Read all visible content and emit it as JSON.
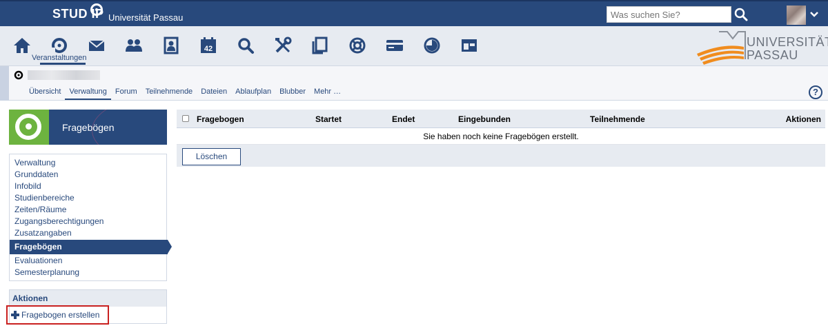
{
  "header": {
    "brand": "STUD IP",
    "university": "Universität Passau",
    "search_placeholder": "Was suchen Sie?"
  },
  "nav": {
    "icons": [
      "home-icon",
      "courses-icon",
      "mail-icon",
      "community-icon",
      "profile-icon",
      "calendar-icon",
      "search-icon",
      "tools-icon",
      "files-icon",
      "help-lifebuoy-icon",
      "card-icon",
      "stats-icon",
      "layout-icon"
    ],
    "calendar_day": "42",
    "active_label": "Veranstaltungen"
  },
  "logo": {
    "line1": "UNIVERSITÄT",
    "line2": "PASSAU"
  },
  "tabs": [
    "Übersicht",
    "Verwaltung",
    "Forum",
    "Teilnehmende",
    "Dateien",
    "Ablaufplan",
    "Blubber",
    "Mehr …"
  ],
  "active_tab": "Verwaltung",
  "sidebar": {
    "title": "Fragebögen",
    "items": [
      "Verwaltung",
      "Grunddaten",
      "Infobild",
      "Studienbereiche",
      "Zeiten/Räume",
      "Zugangsberechtigungen",
      "Zusatzangaben",
      "Fragebögen",
      "Evaluationen",
      "Semesterplanung"
    ],
    "active_item": "Fragebögen",
    "actions_title": "Aktionen",
    "action_create": "Fragebogen erstellen"
  },
  "table": {
    "columns": [
      "Fragebogen",
      "Startet",
      "Endet",
      "Eingebunden",
      "Teilnehmende",
      "Aktionen"
    ],
    "empty_message": "Sie haben noch keine Fragebögen erstellt.",
    "delete_label": "Löschen"
  },
  "colors": {
    "primary": "#28497c",
    "nav_bg": "#e7ebf1",
    "green": "#6db33f",
    "highlight": "#c9201f",
    "logo_orange": "#f08c1e"
  }
}
